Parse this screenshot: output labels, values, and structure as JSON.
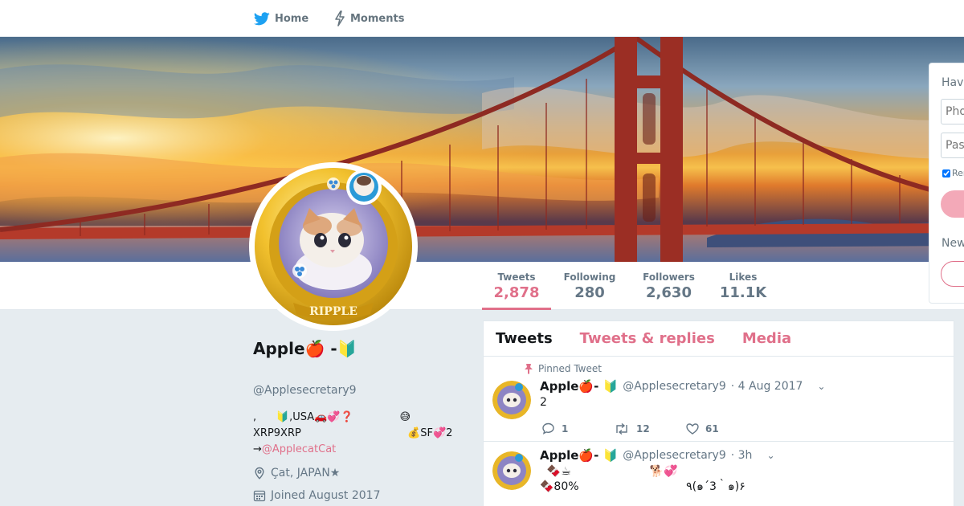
{
  "nav": {
    "home_label": "Home",
    "moments_label": "Moments",
    "icons": {
      "home": "twitter-bird-icon",
      "moments": "lightning-icon"
    }
  },
  "colors": {
    "accent": "#e0708a",
    "twitter_blue": "#1da1f2",
    "page_bg": "#e6ecf0",
    "muted": "#657786"
  },
  "profile": {
    "name": "Apple🍎 -🔰",
    "handle": "@Applesecretary9",
    "bio_line1": ",      🔰,USA🚗💞❓              😅",
    "bio_line2": "XRP9XRP                                💰SF💞2",
    "bio_prefix": "→",
    "bio_link": "@ApplecatCat",
    "location": "Çat, JAPAN★",
    "joined": "Joined August 2017"
  },
  "stats": [
    {
      "label": "Tweets",
      "value": "2,878",
      "active": true
    },
    {
      "label": "Following",
      "value": "280",
      "active": false
    },
    {
      "label": "Followers",
      "value": "2,630",
      "active": false
    },
    {
      "label": "Likes",
      "value": "11.1K",
      "active": false
    }
  ],
  "timeline": {
    "tabs": [
      {
        "label": "Tweets",
        "active": true
      },
      {
        "label": "Tweets & replies",
        "active": false
      },
      {
        "label": "Media",
        "active": false
      }
    ],
    "tweets": [
      {
        "pinned_label": "Pinned Tweet",
        "name": "Apple🍎- 🔰",
        "handle": "@Applesecretary9",
        "time": "· 4 Aug 2017",
        "text": "2",
        "reply_count": "1",
        "retweet_count": "12",
        "like_count": "61"
      },
      {
        "name": "Apple🍎- 🔰",
        "handle": "@Applesecretary9",
        "time": "· 3h",
        "text_line1": "  🍫☕                      🐕💞",
        "text_line2": "🍫80%                              ٩(๑´3｀๑)۶"
      }
    ]
  },
  "login": {
    "title": "Have an account?",
    "phone_placeholder": "Phone, email or username",
    "password_placeholder": "Password",
    "remember_label": "Remember me",
    "new_label": "New to Twitter?"
  }
}
